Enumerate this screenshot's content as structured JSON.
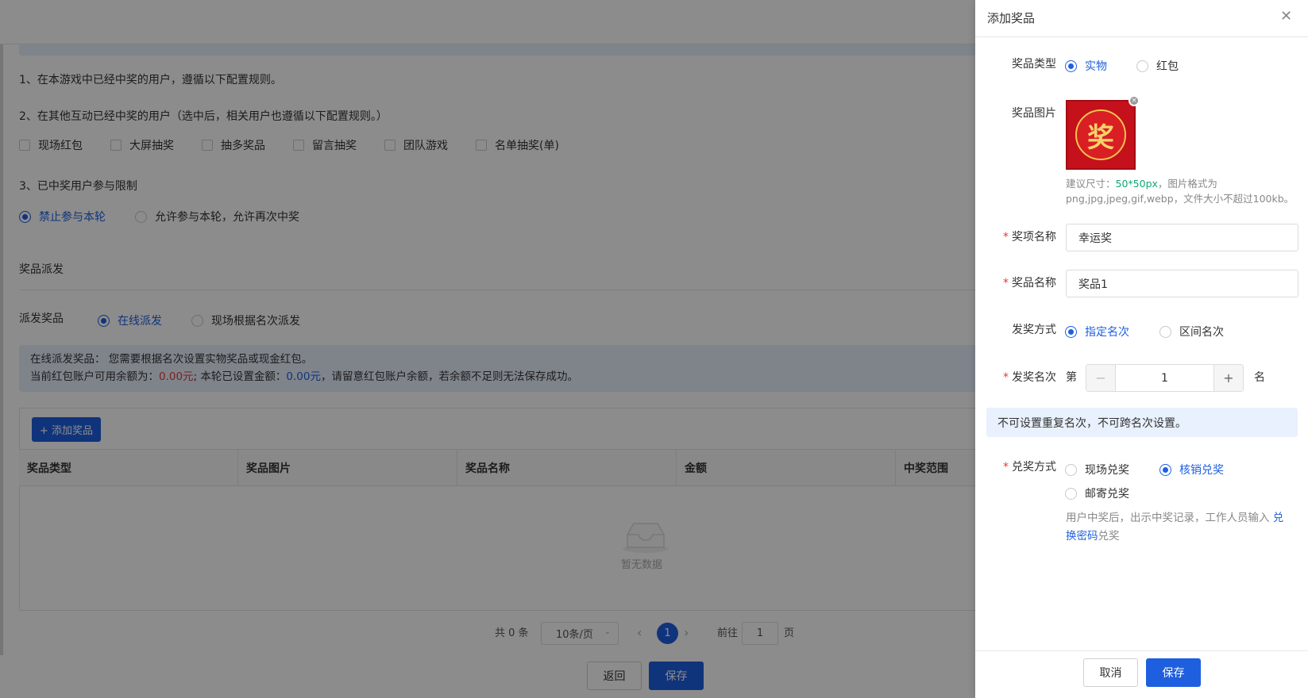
{
  "background": {
    "rules": {
      "rule1": "1、在本游戏中已经中奖的用户，遵循以下配置规则。",
      "rule2": "2、在其他互动已经中奖的用户（选中后，相关用户也遵循以下配置规则。）",
      "checkboxes": [
        "现场红包",
        "大屏抽奖",
        "抽多奖品",
        "留言抽奖",
        "团队游戏",
        "名单抽奖(单)"
      ],
      "rule3": "3、已中奖用户参与限制",
      "limit_options": [
        "禁止参与本轮",
        "允许参与本轮，允许再次中奖"
      ]
    },
    "dispatch": {
      "section_title": "奖品派发",
      "label": "派发奖品",
      "options": [
        "在线派发",
        "现场根据名次派发"
      ],
      "info_line1": "在线派发奖品： 您需要根据名次设置实物奖品或现金红包。",
      "info_line2_a": "当前红包账户可用余额为：",
      "info_line2_b": "0.00元",
      "info_line2_c": "; 本轮已设置金额：",
      "info_line2_d": "0.00元",
      "info_line2_e": "，请留意红包账户余额，若余额不足则无法保存成功。"
    },
    "table": {
      "add_button": "+ 添加奖品",
      "columns": [
        "奖品类型",
        "奖品图片",
        "奖品名称",
        "金额",
        "中奖范围"
      ],
      "empty_text": "暂无数据"
    },
    "pagination": {
      "total": "共 0 条",
      "page_size": "10条/页",
      "current_page": "1",
      "goto_label": "前往",
      "goto_value": "1",
      "page_suffix": "页"
    },
    "footer": {
      "back": "返回",
      "save": "保存"
    }
  },
  "drawer": {
    "title": "添加奖品",
    "prize_type": {
      "label": "奖品类型",
      "options": [
        "实物",
        "红包"
      ],
      "selected": "实物"
    },
    "prize_image": {
      "label": "奖品图片",
      "image_char": "奖",
      "hint_a": "建议尺寸：",
      "hint_size": "50*50px",
      "hint_b": "，图片格式为",
      "hint_c": "png,jpg,jpeg,gif,webp，文件大小不超过100kb。"
    },
    "award_name": {
      "label": "奖项名称",
      "value": "幸运奖"
    },
    "prize_name": {
      "label": "奖品名称",
      "value": "奖品1"
    },
    "award_mode": {
      "label": "发奖方式",
      "options": [
        "指定名次",
        "区间名次"
      ],
      "selected": "指定名次"
    },
    "award_rank": {
      "label": "发奖名次",
      "prefix": "第",
      "minus": "−",
      "value": "1",
      "plus": "+",
      "suffix": "名"
    },
    "tip": "不可设置重复名次，不可跨名次设置。",
    "redeem": {
      "label": "兑奖方式",
      "options": [
        "现场兑奖",
        "核销兑奖",
        "邮寄兑奖"
      ],
      "selected": "核销兑奖",
      "desc_a": "用户中奖后，出示中奖记录，工作人员输入",
      "desc_link1": "兑",
      "desc_link2": "换密码",
      "desc_b": "兑奖"
    },
    "cancel": "取消",
    "save": "保存"
  },
  "colors": {
    "primary": "#1e5fe0",
    "danger": "#e4393c",
    "success": "#12a874"
  }
}
